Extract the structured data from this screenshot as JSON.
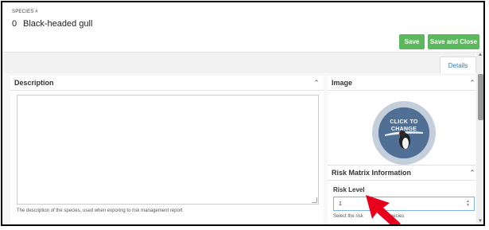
{
  "header": {
    "species_label": "SPECIES #",
    "species_number": "0",
    "species_name": "Black-headed gull"
  },
  "toolbar": {
    "save_label": "Save",
    "save_close_label": "Save and Close",
    "accent_color": "#5cb85c"
  },
  "tabs": [
    {
      "label": "Details",
      "active": true
    }
  ],
  "description_panel": {
    "title": "Description",
    "value": "",
    "help_text": "The description of the species, used when exporing to risk management report"
  },
  "image_panel": {
    "title": "Image",
    "overlay_text": "CLICK TO CHANGE"
  },
  "risk_panel": {
    "title": "Risk Matrix Information",
    "risk_level_label": "Risk Level",
    "risk_level_value": "1",
    "help_text_left": "Select the risk",
    "help_text_right": "species"
  },
  "annotation": {
    "arrow_color": "#e8001c"
  }
}
